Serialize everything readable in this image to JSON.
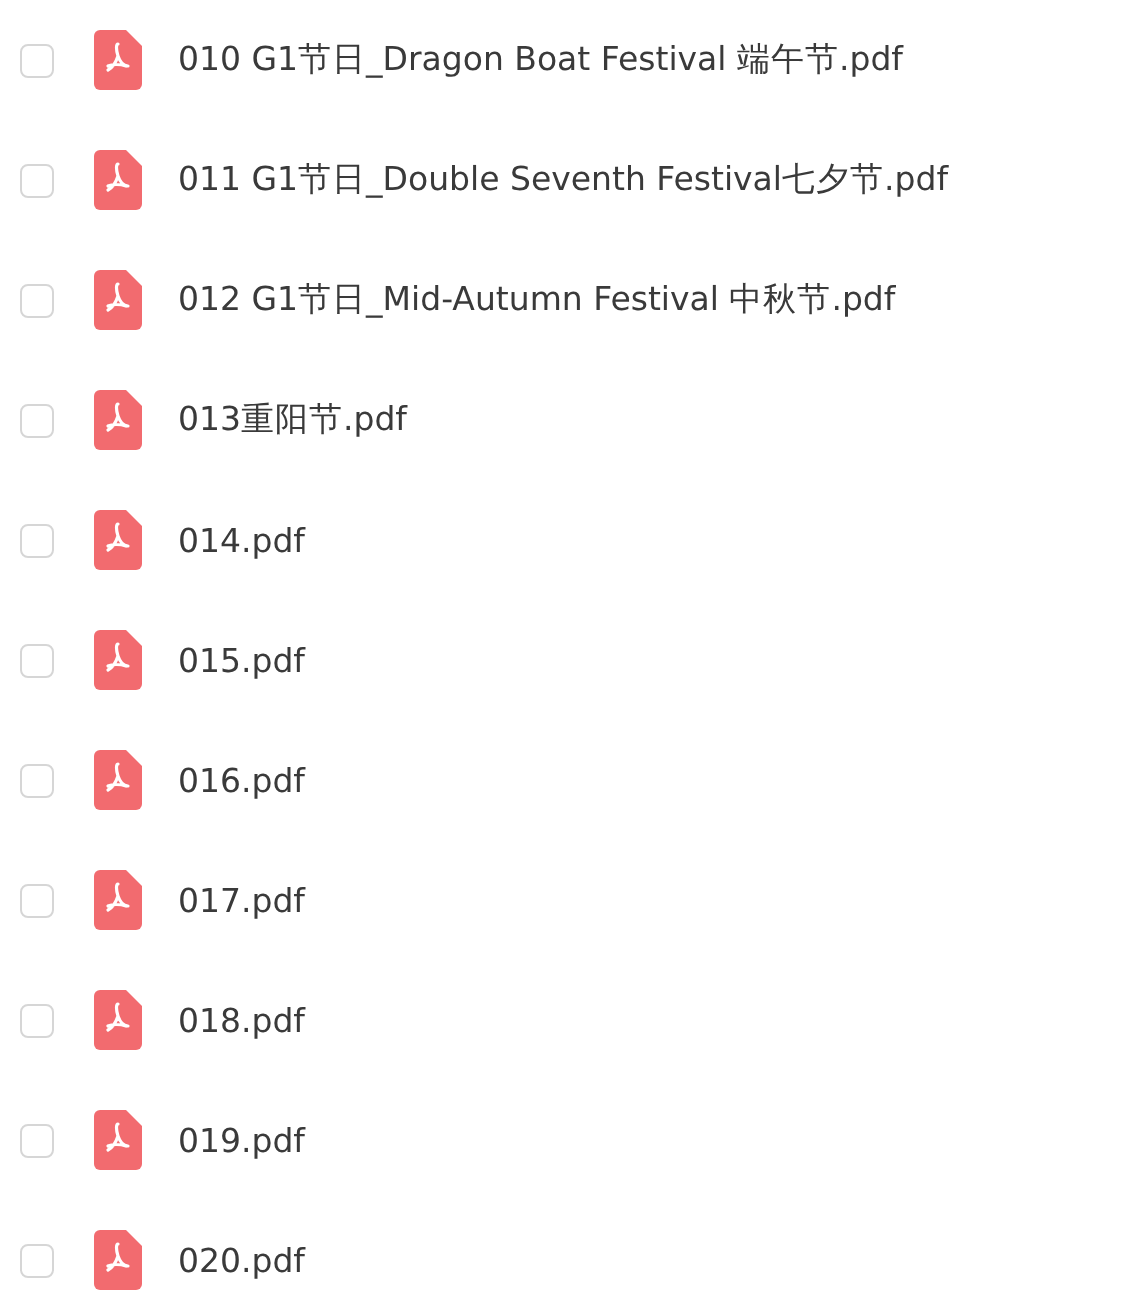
{
  "files": [
    {
      "name": "010 G1节日_Dragon Boat Festival 端午节.pdf",
      "checked": false
    },
    {
      "name": "011 G1节日_Double Seventh Festival七夕节.pdf",
      "checked": false
    },
    {
      "name": "012 G1节日_Mid-Autumn Festival 中秋节.pdf",
      "checked": false
    },
    {
      "name": "013重阳节.pdf",
      "checked": false
    },
    {
      "name": "014.pdf",
      "checked": false
    },
    {
      "name": "015.pdf",
      "checked": false
    },
    {
      "name": "016.pdf",
      "checked": false
    },
    {
      "name": "017.pdf",
      "checked": false
    },
    {
      "name": "018.pdf",
      "checked": false
    },
    {
      "name": "019.pdf",
      "checked": false
    },
    {
      "name": "020.pdf",
      "checked": false
    }
  ]
}
